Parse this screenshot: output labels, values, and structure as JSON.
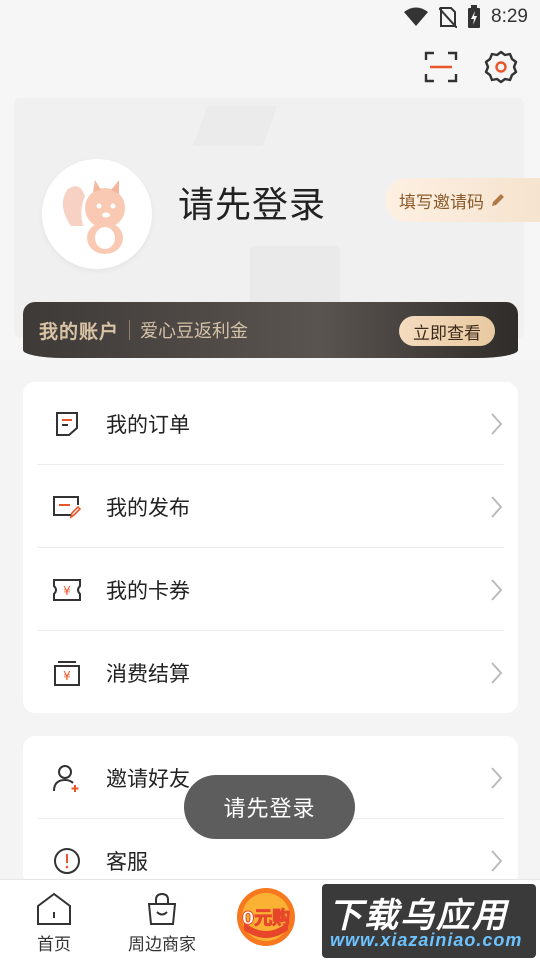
{
  "status_bar": {
    "time": "8:29",
    "icons": [
      "wifi-icon",
      "no-sim-icon",
      "battery-charging-icon"
    ]
  },
  "header": {
    "login_title": "请先登录",
    "invite_label": "填写邀请码",
    "icons": [
      "scan-icon",
      "settings-icon",
      "edit-pencil-icon",
      "squirrel-avatar-icon"
    ]
  },
  "account": {
    "title": "我的账户",
    "subtitle": "爱心豆返利金",
    "view_label": "立即查看"
  },
  "menu1": [
    {
      "label": "我的订单",
      "icon": "order-icon"
    },
    {
      "label": "我的发布",
      "icon": "publish-icon"
    },
    {
      "label": "我的卡券",
      "icon": "coupon-icon"
    },
    {
      "label": "消费结算",
      "icon": "settlement-icon"
    }
  ],
  "menu2": [
    {
      "label": "邀请好友",
      "icon": "invite-friend-icon"
    },
    {
      "label": "客服",
      "icon": "customer-service-icon"
    }
  ],
  "toast": "请先登录",
  "tabbar": {
    "home": "首页",
    "nearby": "周边商家",
    "zero_buy": "0元购",
    "watermark_title": "下载乌应用",
    "watermark_url": "www.xiazainiao.com"
  },
  "colors": {
    "accent": "#e8562a",
    "gold": "#d9c3a5",
    "banner_dark": "#3e3a37"
  }
}
